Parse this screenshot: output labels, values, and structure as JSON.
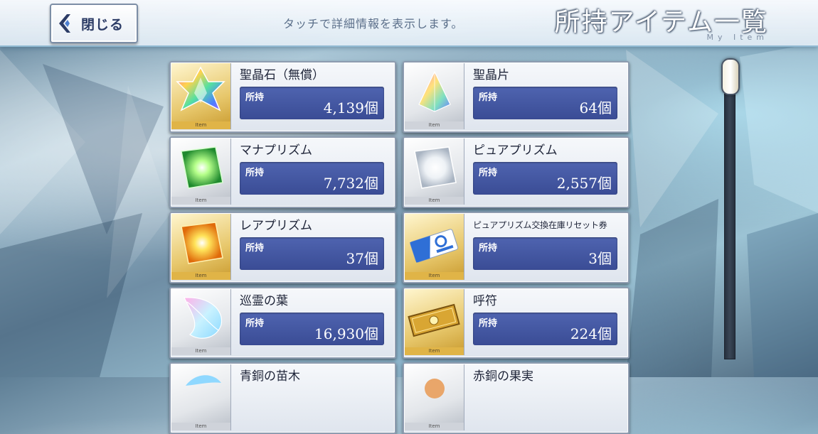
{
  "header": {
    "close_label": "閉じる",
    "hint": "タッチで詳細情報を表示します。",
    "title": "所持アイテム一覧",
    "subtitle": "My Item"
  },
  "item_tag": "Item",
  "items": [
    {
      "name": "聖晶石（無償）",
      "owned_label": "所持",
      "count": "4,139個",
      "frame": "gold",
      "icon": "saint-quartz-icon"
    },
    {
      "name": "聖晶片",
      "owned_label": "所持",
      "count": "64個",
      "frame": "silver",
      "icon": "quartz-fragment-icon"
    },
    {
      "name": "マナプリズム",
      "owned_label": "所持",
      "count": "7,732個",
      "frame": "silver",
      "icon": "mana-prism-icon"
    },
    {
      "name": "ピュアプリズム",
      "owned_label": "所持",
      "count": "2,557個",
      "frame": "silver",
      "icon": "pure-prism-icon"
    },
    {
      "name": "レアプリズム",
      "owned_label": "所持",
      "count": "37個",
      "frame": "gold",
      "icon": "rare-prism-icon"
    },
    {
      "name": "ピュアプリズム交換在庫リセット券",
      "owned_label": "所持",
      "count": "3個",
      "frame": "gold",
      "icon": "reset-ticket-icon"
    },
    {
      "name": "巡霊の葉",
      "owned_label": "所持",
      "count": "16,930個",
      "frame": "silver",
      "icon": "spirit-leaf-icon"
    },
    {
      "name": "呼符",
      "owned_label": "所持",
      "count": "224個",
      "frame": "gold",
      "icon": "summon-ticket-icon"
    },
    {
      "name": "青銅の苗木",
      "owned_label": "",
      "count": "",
      "frame": "silver",
      "icon": "bronze-sapling-icon"
    },
    {
      "name": "赤銅の果実",
      "owned_label": "",
      "count": "",
      "frame": "silver",
      "icon": "copper-fruit-icon"
    }
  ],
  "colors": {
    "owned_panel": "#3f52a0",
    "gold_frame": "#e0b447",
    "silver_frame": "#cfd3da"
  }
}
